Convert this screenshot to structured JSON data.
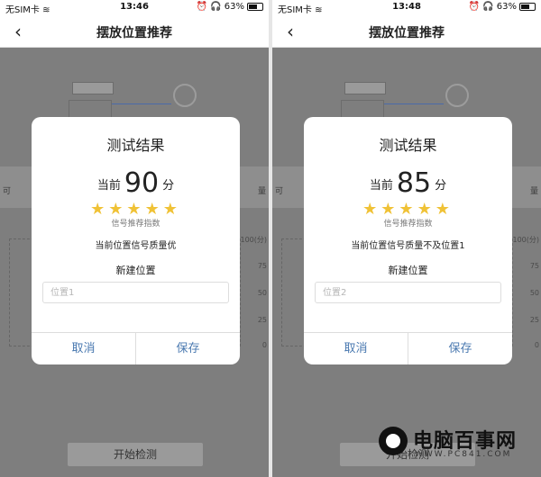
{
  "screens": [
    {
      "status": {
        "carrier": "无SIM卡",
        "time": "13:46",
        "battery": "63%"
      },
      "nav": {
        "title": "摆放位置推荐"
      },
      "background": {
        "side_left": "可",
        "side_right": "量",
        "axis": [
          "100(分)",
          "75",
          "50",
          "25",
          "0"
        ],
        "start_button": "开始检测"
      },
      "dialog": {
        "title": "测试结果",
        "score_prefix": "当前",
        "score": "90",
        "score_suffix": "分",
        "stars": 5,
        "stars_caption": "信号推荐指数",
        "quality_text": "当前位置信号质量优",
        "new_position_label": "新建位置",
        "input_placeholder": "位置1",
        "cancel_label": "取消",
        "save_label": "保存"
      }
    },
    {
      "status": {
        "carrier": "无SIM卡",
        "time": "13:48",
        "battery": "63%"
      },
      "nav": {
        "title": "摆放位置推荐"
      },
      "background": {
        "side_left": "可",
        "side_right": "量",
        "axis": [
          "100(分)",
          "75",
          "50",
          "25",
          "0"
        ],
        "start_button": "开始检测"
      },
      "dialog": {
        "title": "测试结果",
        "score_prefix": "当前",
        "score": "85",
        "score_suffix": "分",
        "stars": 5,
        "stars_caption": "信号推荐指数",
        "quality_text": "当前位置信号质量不及位置1",
        "new_position_label": "新建位置",
        "input_placeholder": "位置2",
        "cancel_label": "取消",
        "save_label": "保存"
      }
    }
  ],
  "watermark": {
    "name": "电脑百事网",
    "url": "WWW.PC841.COM"
  },
  "colors": {
    "accent": "#4a79b0",
    "star": "#f0c236",
    "overlay": "#7e7e7e"
  }
}
